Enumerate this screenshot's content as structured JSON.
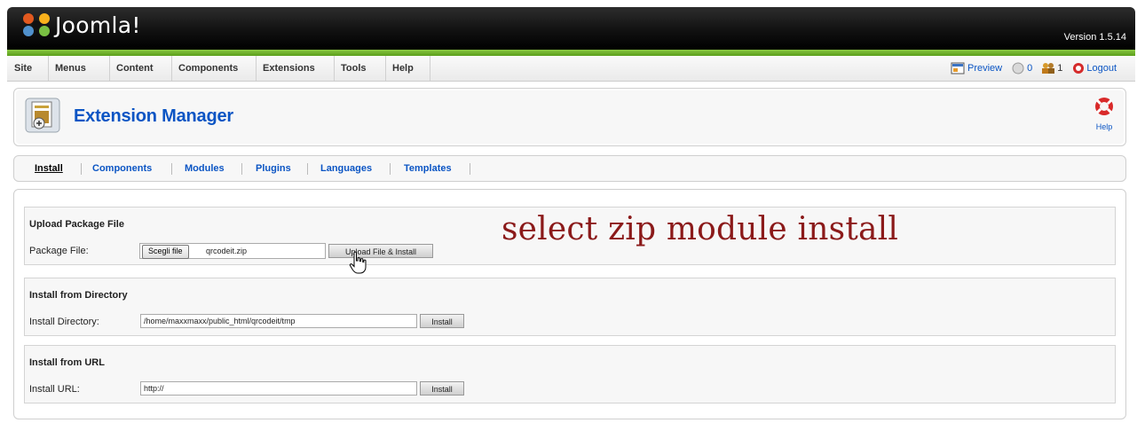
{
  "header": {
    "logo_text": "Joomla!",
    "version": "Version 1.5.14"
  },
  "menu": {
    "items": [
      "Site",
      "Menus",
      "Content",
      "Components",
      "Extensions",
      "Tools",
      "Help"
    ],
    "preview": "Preview",
    "messages_count": "0",
    "users_count": "1",
    "logout": "Logout"
  },
  "toolbar": {
    "title": "Extension Manager",
    "help": "Help"
  },
  "tabs": [
    "Install",
    "Components",
    "Modules",
    "Plugins",
    "Languages",
    "Templates"
  ],
  "upload": {
    "title": "Upload Package File",
    "label": "Package File:",
    "choose_button": "Scegli file",
    "file_name": "qrcodeit.zip",
    "button": "Upload File & Install"
  },
  "directory": {
    "title": "Install from Directory",
    "label": "Install Directory:",
    "value": "/home/maxxmaxx/public_html/qrcodeit/tmp",
    "button": "Install"
  },
  "url": {
    "title": "Install from URL",
    "label": "Install URL:",
    "value": "http://",
    "button": "Install"
  },
  "annotation": "select zip module install",
  "colors": {
    "link": "#0b55c4",
    "header_green": "#6bb324",
    "annotation": "#8b1a1a"
  }
}
